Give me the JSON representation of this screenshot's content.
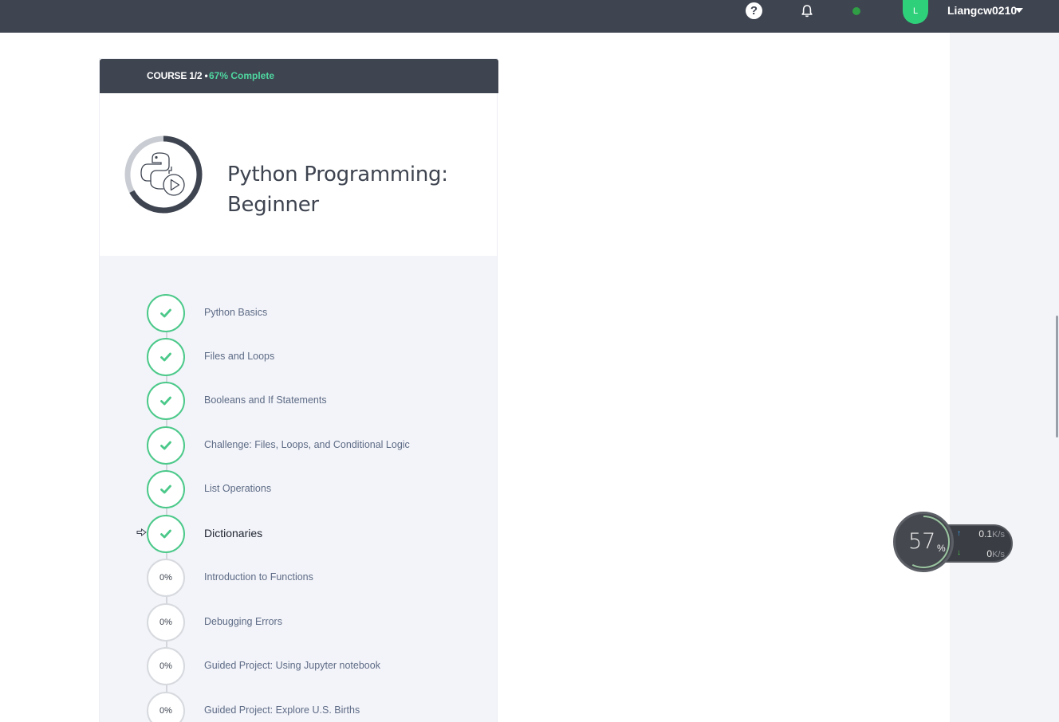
{
  "topbar": {
    "help_icon": "question-circle-icon",
    "help_glyph": "?",
    "notifications_icon": "bell-icon",
    "status_color": "#2f9e44",
    "avatar_initial": "L",
    "avatar_color": "#2fd07a",
    "username": "Liangcw0210",
    "menu_icon": "caret-down-icon"
  },
  "course": {
    "position": "COURSE 1/2",
    "separator": "•",
    "complete": "67% Complete",
    "title": "Python Programming: Beginner",
    "progress": 0.67,
    "icon": "python-play-icon"
  },
  "lessons": [
    {
      "label": "Python Basics",
      "status": "done"
    },
    {
      "label": "Files and Loops",
      "status": "done"
    },
    {
      "label": "Booleans and If Statements",
      "status": "done"
    },
    {
      "label": "Challenge: Files, Loops, and Conditional Logic",
      "status": "done"
    },
    {
      "label": "List Operations",
      "status": "done"
    },
    {
      "label": "Dictionaries",
      "status": "done",
      "current": true
    },
    {
      "label": "Introduction to Functions",
      "status": "todo",
      "progress": "0%"
    },
    {
      "label": "Debugging Errors",
      "status": "todo",
      "progress": "0%"
    },
    {
      "label": "Guided Project: Using Jupyter notebook",
      "status": "todo",
      "progress": "0%"
    },
    {
      "label": "Guided Project: Explore U.S. Births",
      "status": "todo",
      "progress": "0%"
    }
  ],
  "speed_widget": {
    "value": "57",
    "unit": "%",
    "level": 0.57,
    "upload": "0.1",
    "upload_unit": "K/s",
    "download": "0",
    "download_unit": "K/s"
  },
  "colors": {
    "header_bg": "#3e4450",
    "accent_green": "#4cc98a",
    "complete_text": "#4fd6a0",
    "lesson_text": "#5d6b86",
    "panel_bg": "#f3f4f9"
  }
}
